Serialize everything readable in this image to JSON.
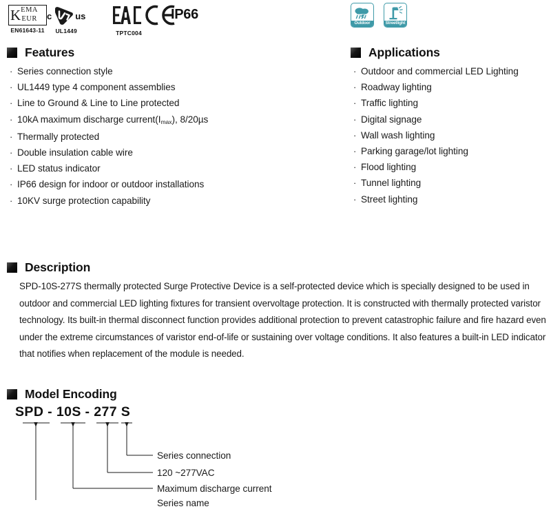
{
  "certifications": [
    {
      "id": "kema-keur",
      "mark": "KEMA KEUR",
      "letter": "K",
      "line1": "EMA",
      "line2": "EUR",
      "standard": "EN61643-11"
    },
    {
      "id": "culus",
      "mark": "cULus",
      "prefix": "c",
      "suffix": "us",
      "standard": "UL1449"
    },
    {
      "id": "eac",
      "mark": "EAC",
      "standard": "TPTC004"
    },
    {
      "id": "ce",
      "mark": "CE",
      "standard": ""
    },
    {
      "id": "ip66",
      "mark": "IP66",
      "standard": ""
    }
  ],
  "application_icons": [
    {
      "id": "outdoor",
      "icon": "cloud-rain-icon",
      "label": "Outdoor"
    },
    {
      "id": "streetlight",
      "icon": "streetlamp-icon",
      "label": "Streetlight"
    }
  ],
  "features": {
    "title": "Features",
    "items": [
      {
        "text": "Series connection style"
      },
      {
        "text": "UL1449 type 4 component assemblies"
      },
      {
        "text": "Line to Ground & Line to Line protected"
      },
      {
        "pre": "10kA maximum discharge current(I",
        "sub": "max",
        "post": "), 8/20µs"
      },
      {
        "text": "Thermally protected"
      },
      {
        "text": "Double insulation cable wire"
      },
      {
        "text": "LED status indicator"
      },
      {
        "text": "IP66 design for indoor or outdoor installations"
      },
      {
        "text": "10KV surge protection capability"
      }
    ]
  },
  "applications": {
    "title": "Applications",
    "items": [
      {
        "text": "Outdoor and commercial LED Lighting"
      },
      {
        "text": "Roadway lighting"
      },
      {
        "text": "Traffic lighting"
      },
      {
        "text": "Digital signage"
      },
      {
        "text": "Wall wash lighting"
      },
      {
        "text": "Parking garage/lot lighting"
      },
      {
        "text": "Flood lighting"
      },
      {
        "text": "Tunnel lighting"
      },
      {
        "text": "Street lighting"
      }
    ]
  },
  "description": {
    "title": "Description",
    "body": "SPD-10S-277S thermally protected Surge Protective Device is a self-protected device which is specially designed to be used in outdoor and commercial LED lighting fixtures for transient overvoltage protection. It is constructed with thermally protected varistor technology. Its built-in thermal disconnect function provides additional protection to prevent catastrophic failure and fire hazard even under the extreme circumstances of varistor end-of-life or sustaining over voltage conditions. It also features a built-in LED indicator that notifies when replacement of the module is needed."
  },
  "model_encoding": {
    "title": "Model Encoding",
    "code": "SPD - 10S - 277 S",
    "labels": [
      {
        "id": "series-connection",
        "text": "Series connection"
      },
      {
        "id": "voltage",
        "text": "120 ~277VAC"
      },
      {
        "id": "max-discharge-current",
        "text": "Maximum discharge current"
      },
      {
        "id": "series-name",
        "text": "Series name"
      }
    ]
  },
  "colors": {
    "accent_teal": "#3f9aa8",
    "text": "#1a1a1a",
    "heading": "#111111"
  }
}
